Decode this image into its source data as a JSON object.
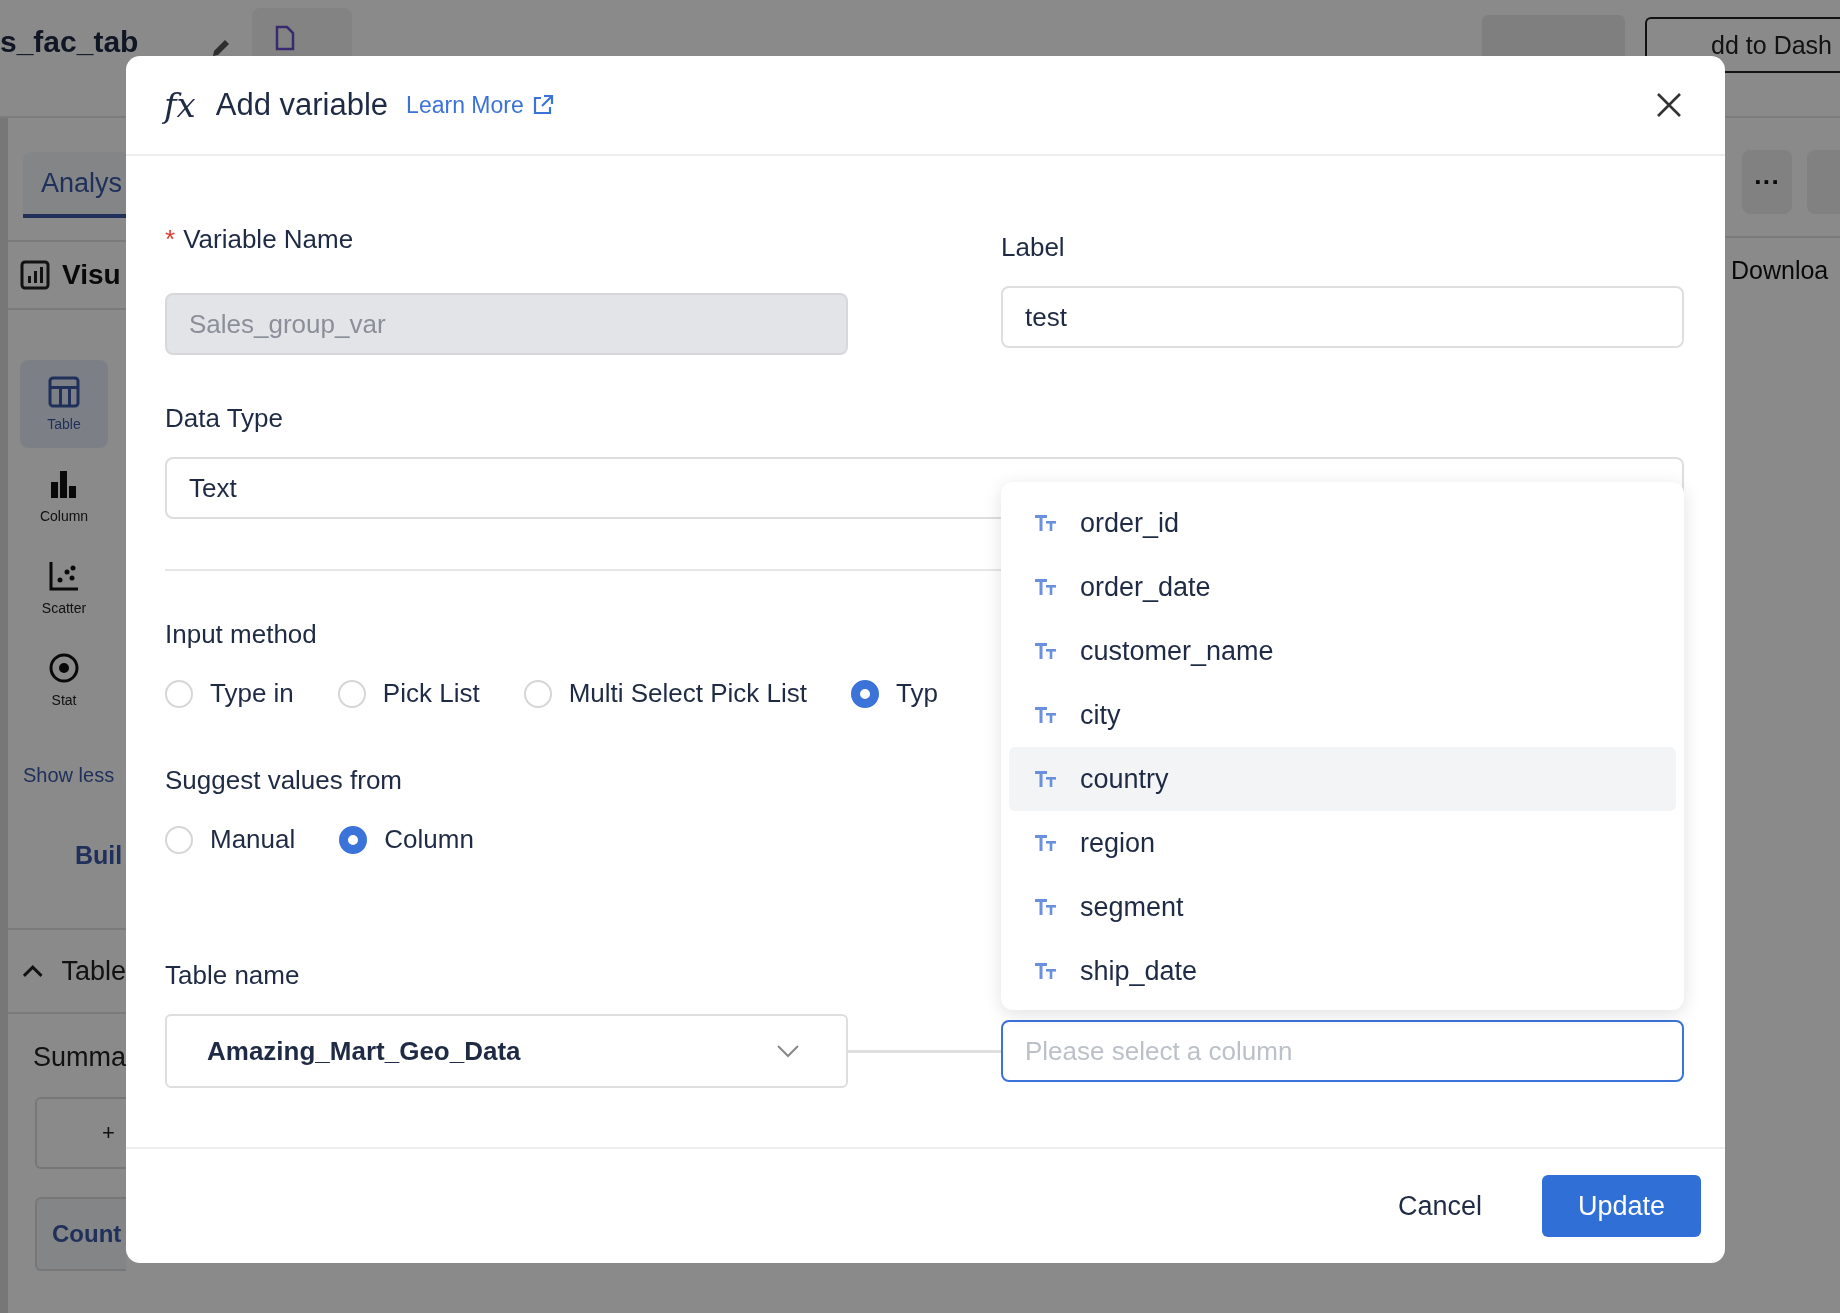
{
  "background": {
    "title": "s_fac_tab",
    "add_button": "dd to Dash",
    "tab": "Analys",
    "section": "Visu",
    "chart_types": [
      {
        "kind": "table",
        "label": "Table",
        "selected": true
      },
      {
        "kind": "column",
        "label": "Column",
        "selected": false
      },
      {
        "kind": "scatter",
        "label": "Scatter",
        "selected": false
      },
      {
        "kind": "stat",
        "label": "Stat",
        "selected": false
      }
    ],
    "show_less": "Show less",
    "build": "Buil",
    "table_section": "Table",
    "summary": "Summa",
    "add_field": "+",
    "count": "Count",
    "more_button": "···",
    "download": "Downloa"
  },
  "dialog": {
    "function_symbol": "fx",
    "title": "Add variable",
    "learn_more": "Learn More",
    "variable_name": {
      "required_mark": "*",
      "label": "Variable Name",
      "value": "Sales_group_var",
      "disabled": true
    },
    "label_field": {
      "label": "Label",
      "value": "test"
    },
    "data_type": {
      "label": "Data Type",
      "value": "Text"
    },
    "input_method": {
      "label": "Input method",
      "options": [
        {
          "label": "Type in",
          "selected": false
        },
        {
          "label": "Pick List",
          "selected": false
        },
        {
          "label": "Multi Select Pick List",
          "selected": false
        },
        {
          "label": "Typ",
          "selected": true
        }
      ]
    },
    "suggest_values": {
      "label": "Suggest values from",
      "options": [
        {
          "label": "Manual",
          "selected": false
        },
        {
          "label": "Column",
          "selected": true
        }
      ]
    },
    "table_name": {
      "label": "Table name",
      "value": "Amazing_Mart_Geo_Data"
    },
    "column_field": {
      "placeholder": "Please select a column",
      "focused": true
    },
    "column_menu": [
      {
        "label": "order_id",
        "highlighted": false
      },
      {
        "label": "order_date",
        "highlighted": false
      },
      {
        "label": "customer_name",
        "highlighted": false
      },
      {
        "label": "city",
        "highlighted": false
      },
      {
        "label": "country",
        "highlighted": true
      },
      {
        "label": "region",
        "highlighted": false
      },
      {
        "label": "segment",
        "highlighted": false
      },
      {
        "label": "ship_date",
        "highlighted": false
      }
    ],
    "buttons": [
      {
        "kind": "secondary",
        "label": "Cancel"
      },
      {
        "kind": "primary",
        "label": "Update"
      }
    ]
  }
}
